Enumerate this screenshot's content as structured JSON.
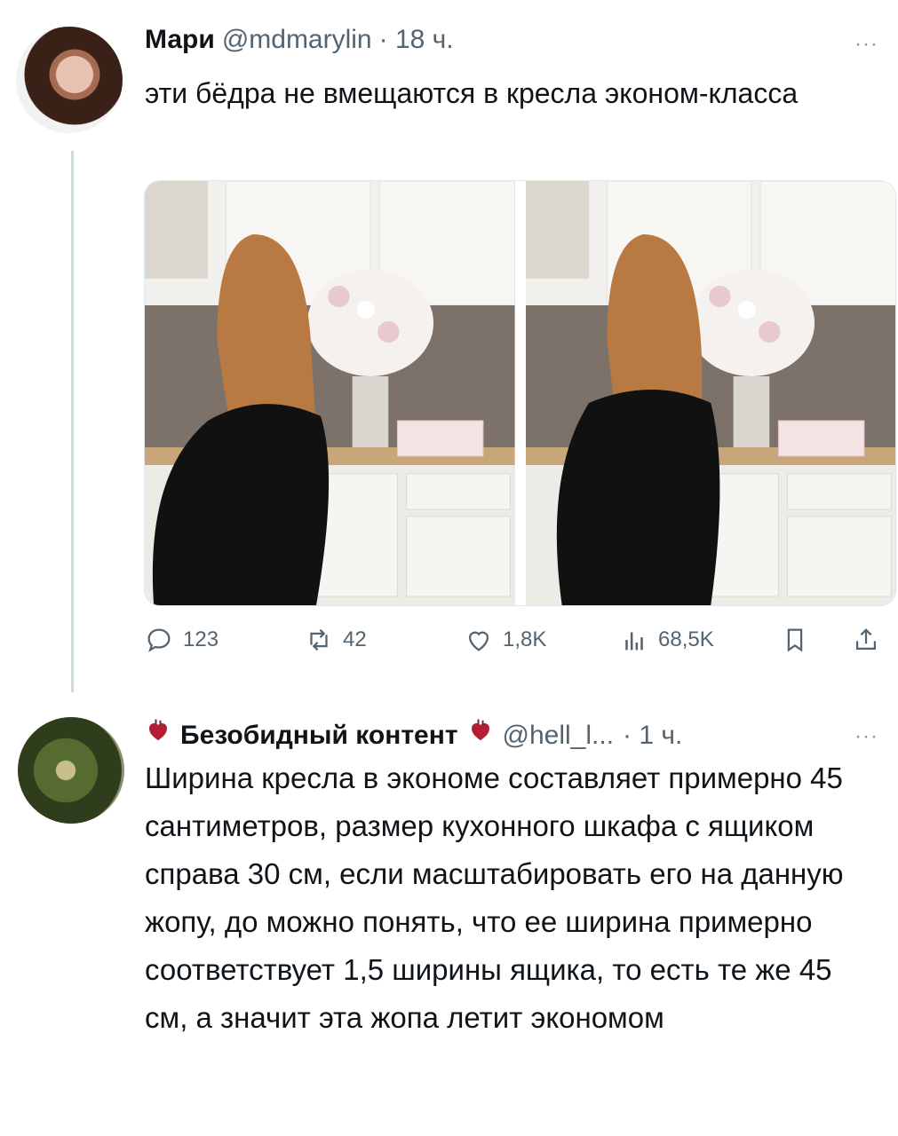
{
  "tweet": {
    "author_name": "Мари",
    "handle": "@mdmarylin",
    "time": "· 18 ч.",
    "more": "···",
    "text": "эти бёдра не вмещаются в кресла эконом-класса",
    "stats": {
      "replies": "123",
      "retweets": "42",
      "likes": "1,8K",
      "views": "68,5K"
    }
  },
  "reply": {
    "author_name": "Безобидный контент",
    "handle": "@hell_l...",
    "time": "· 1 ч.",
    "more": "···",
    "text": "Ширина кресла в экономе составляет примерно 45 сантиметров, размер кухонного шкафа с ящиком справа 30 см, если масштабировать его на данную жопу, до можно понять, что ее ширина примерно соответствует 1,5 ширины ящика, то есть те же 45 см, а значит эта жопа летит экономом"
  },
  "colors": {
    "text": "#0f1419",
    "secondary": "#536471",
    "thread_line": "#cfd9de"
  },
  "icons": [
    "reply-icon",
    "retweet-icon",
    "like-icon",
    "views-icon",
    "bookmark-icon",
    "share-icon",
    "anatomical-heart-icon"
  ]
}
